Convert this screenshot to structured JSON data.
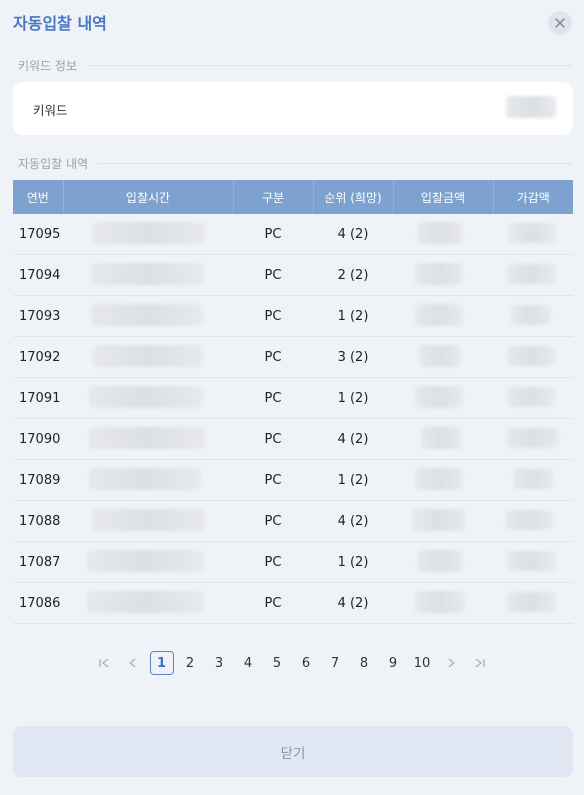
{
  "modal": {
    "title": "자동입찰 내역"
  },
  "keyword_section": {
    "label": "키워드 정보",
    "field_label": "키워드"
  },
  "bids_section": {
    "label": "자동입찰 내역"
  },
  "table": {
    "headers": [
      "연번",
      "입찰시간",
      "구분",
      "순위 (희망)",
      "입찰금액",
      "가감액"
    ],
    "rows": [
      {
        "seq": "17095",
        "type": "PC",
        "rank": "4 (2)",
        "highlight": false
      },
      {
        "seq": "17094",
        "type": "PC",
        "rank": "2 (2)",
        "highlight": true
      },
      {
        "seq": "17093",
        "type": "PC",
        "rank": "1 (2)",
        "highlight": false
      },
      {
        "seq": "17092",
        "type": "PC",
        "rank": "3 (2)",
        "highlight": false
      },
      {
        "seq": "17091",
        "type": "PC",
        "rank": "1 (2)",
        "highlight": false
      },
      {
        "seq": "17090",
        "type": "PC",
        "rank": "4 (2)",
        "highlight": false
      },
      {
        "seq": "17089",
        "type": "PC",
        "rank": "1 (2)",
        "highlight": false
      },
      {
        "seq": "17088",
        "type": "PC",
        "rank": "4 (2)",
        "highlight": false
      },
      {
        "seq": "17087",
        "type": "PC",
        "rank": "1 (2)",
        "highlight": false
      },
      {
        "seq": "17086",
        "type": "PC",
        "rank": "4 (2)",
        "highlight": false
      }
    ]
  },
  "pagination": {
    "first_icon": "first-page-icon",
    "prev_icon": "prev-page-icon",
    "pages": [
      "1",
      "2",
      "3",
      "4",
      "5",
      "6",
      "7",
      "8",
      "9",
      "10"
    ],
    "current": "1",
    "next_icon": "next-page-icon",
    "last_icon": "last-page-icon"
  },
  "footer": {
    "close_label": "닫기"
  },
  "colors": {
    "accent": "#4a76c6",
    "header_bg": "#7ea2cf",
    "rank_highlight": "#3fa56a"
  }
}
